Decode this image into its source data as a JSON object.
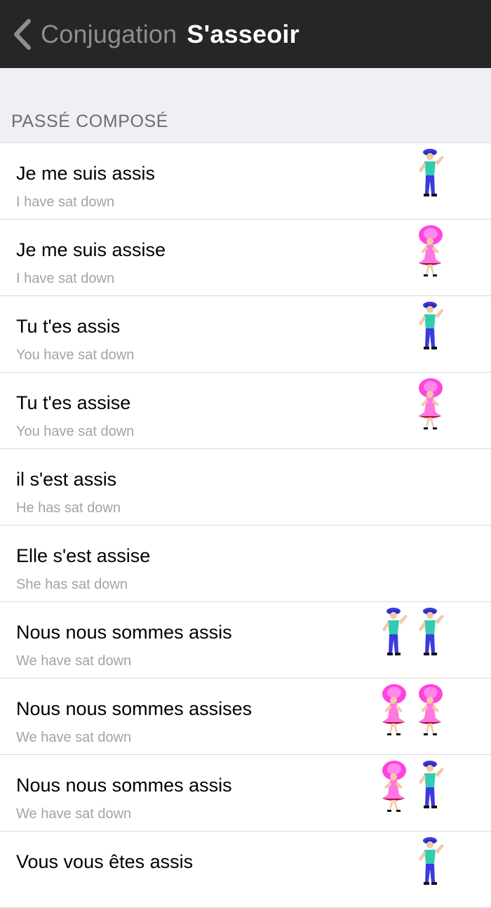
{
  "navbar": {
    "back_label": "Conjugation",
    "title": "S'asseoir"
  },
  "section": {
    "title": "PASSÉ COMPOSÉ"
  },
  "rows": [
    {
      "title": "Je me suis assis",
      "subtitle": "I have sat down",
      "figures": [
        "boy"
      ]
    },
    {
      "title": "Je me suis assise",
      "subtitle": "I have sat down",
      "figures": [
        "girl"
      ]
    },
    {
      "title": "Tu t'es assis",
      "subtitle": "You have sat down",
      "figures": [
        "boy"
      ]
    },
    {
      "title": "Tu t'es assise",
      "subtitle": "You have sat down",
      "figures": [
        "girl"
      ]
    },
    {
      "title": "il s'est assis",
      "subtitle": "He has sat down",
      "figures": []
    },
    {
      "title": "Elle s'est assise",
      "subtitle": "She has sat down",
      "figures": []
    },
    {
      "title": "Nous nous sommes assis",
      "subtitle": "We have sat down",
      "figures": [
        "boy",
        "boy"
      ]
    },
    {
      "title": "Nous nous sommes assises",
      "subtitle": "We have sat down",
      "figures": [
        "girl",
        "girl"
      ]
    },
    {
      "title": "Nous nous sommes assis",
      "subtitle": "We have sat down",
      "figures": [
        "girl",
        "boy"
      ]
    },
    {
      "title": "Vous vous êtes assis",
      "subtitle": "",
      "figures": [
        "boy"
      ]
    }
  ],
  "colors": {
    "navbar_bg": "#262626",
    "section_bg": "#efeff4",
    "boy_shirt": "#33ccb0",
    "boy_pants": "#3a3adf",
    "girl_hat": "#ff44dd",
    "girl_dress": "#ff77e0"
  }
}
